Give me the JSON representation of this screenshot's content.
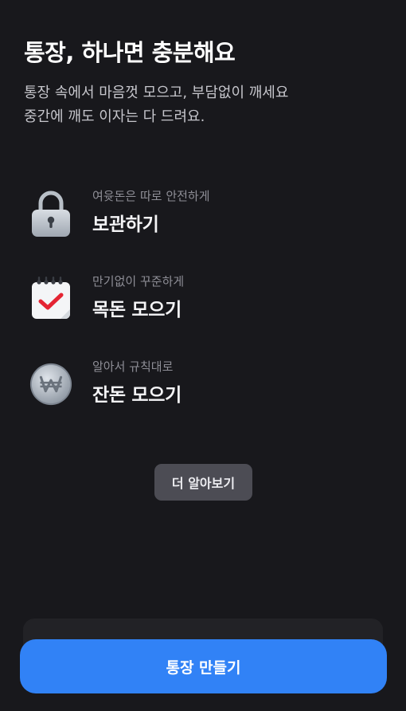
{
  "hero": {
    "title": "통장, 하나면 충분해요",
    "subtitle_line1": "통장 속에서 마음껏 모으고, 부담없이 깨세요",
    "subtitle_line2": "중간에 깨도 이자는 다 드려요."
  },
  "features": [
    {
      "icon": "lock-icon",
      "sub": "여윳돈은 따로 안전하게",
      "main": "보관하기"
    },
    {
      "icon": "calendar-check-icon",
      "sub": "만기없이 꾸준하게",
      "main": "목돈 모으기"
    },
    {
      "icon": "won-coin-icon",
      "sub": "알아서 규칙대로",
      "main": "잔돈 모으기"
    }
  ],
  "more_button": "더 알아보기",
  "cta_button": "통장 만들기",
  "colors": {
    "background": "#18181c",
    "accent": "#3182f6",
    "secondary_button": "#4c4c54"
  }
}
